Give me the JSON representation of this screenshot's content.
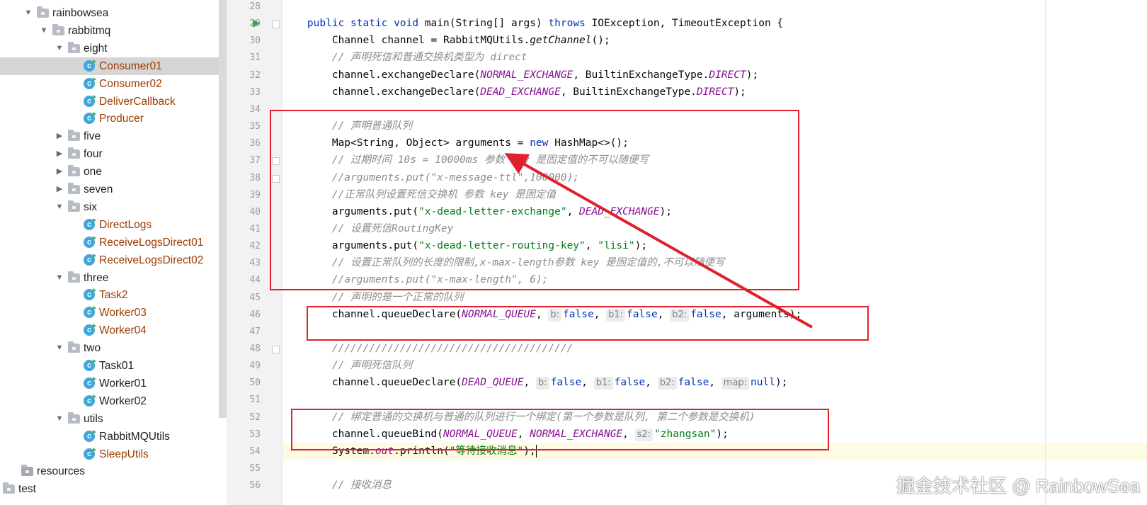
{
  "tree": {
    "items": [
      {
        "label": "rainbowsea",
        "kind": "folder",
        "expanded": true,
        "depth": 2
      },
      {
        "label": "rabbitmq",
        "kind": "folder",
        "expanded": true,
        "depth": 3
      },
      {
        "label": "eight",
        "kind": "folder",
        "expanded": true,
        "depth": 4
      },
      {
        "label": "Consumer01",
        "kind": "class",
        "depth": 5,
        "selected": true,
        "vcs": "modified"
      },
      {
        "label": "Consumer02",
        "kind": "class",
        "depth": 5,
        "vcs": "modified"
      },
      {
        "label": "DeliverCallback",
        "kind": "class",
        "depth": 5,
        "vcs": "modified"
      },
      {
        "label": "Producer",
        "kind": "class",
        "depth": 5,
        "vcs": "modified"
      },
      {
        "label": "five",
        "kind": "folder",
        "expanded": false,
        "depth": 4
      },
      {
        "label": "four",
        "kind": "folder",
        "expanded": false,
        "depth": 4
      },
      {
        "label": "one",
        "kind": "folder",
        "expanded": false,
        "depth": 4
      },
      {
        "label": "seven",
        "kind": "folder",
        "expanded": false,
        "depth": 4
      },
      {
        "label": "six",
        "kind": "folder",
        "expanded": true,
        "depth": 4
      },
      {
        "label": "DirectLogs",
        "kind": "class",
        "depth": 5,
        "vcs": "modified"
      },
      {
        "label": "ReceiveLogsDirect01",
        "kind": "class",
        "depth": 5,
        "vcs": "modified"
      },
      {
        "label": "ReceiveLogsDirect02",
        "kind": "class",
        "depth": 5,
        "vcs": "modified"
      },
      {
        "label": "three",
        "kind": "folder",
        "expanded": true,
        "depth": 4
      },
      {
        "label": "Task2",
        "kind": "class",
        "depth": 5,
        "vcs": "modified"
      },
      {
        "label": "Worker03",
        "kind": "class",
        "depth": 5,
        "vcs": "modified"
      },
      {
        "label": "Worker04",
        "kind": "class",
        "depth": 5,
        "vcs": "modified"
      },
      {
        "label": "two",
        "kind": "folder",
        "expanded": true,
        "depth": 4
      },
      {
        "label": "Task01",
        "kind": "class",
        "depth": 5,
        "vcs": "none"
      },
      {
        "label": "Worker01",
        "kind": "class",
        "depth": 5,
        "vcs": "none"
      },
      {
        "label": "Worker02",
        "kind": "class",
        "depth": 5,
        "vcs": "none"
      },
      {
        "label": "utils",
        "kind": "folder",
        "expanded": true,
        "depth": 4
      },
      {
        "label": "RabbitMQUtils",
        "kind": "class",
        "depth": 5,
        "vcs": "none"
      },
      {
        "label": "SleepUtils",
        "kind": "class",
        "depth": 5,
        "vcs": "modified"
      },
      {
        "label": "resources",
        "kind": "resource-folder",
        "depth": 1
      },
      {
        "label": "test",
        "kind": "folder-plain",
        "depth": 0
      }
    ]
  },
  "editor": {
    "lines": [
      {
        "n": "28",
        "segs": []
      },
      {
        "n": "29",
        "segs": [
          {
            "t": "    "
          },
          {
            "t": "public static void ",
            "c": "kw"
          },
          {
            "t": "main(String[] args) "
          },
          {
            "t": "throws ",
            "c": "kw"
          },
          {
            "t": "IOException, TimeoutException {"
          }
        ]
      },
      {
        "n": "30",
        "segs": [
          {
            "t": "        Channel channel = RabbitMQUtils."
          },
          {
            "t": "getChannel",
            "c": "it"
          },
          {
            "t": "();"
          }
        ]
      },
      {
        "n": "31",
        "segs": [
          {
            "t": "        "
          },
          {
            "t": "// 声明死信和普通交换机类型为 direct",
            "c": "cm"
          }
        ]
      },
      {
        "n": "32",
        "segs": [
          {
            "t": "        channel.exchangeDeclare("
          },
          {
            "t": "NORMAL_EXCHANGE",
            "c": "fd"
          },
          {
            "t": ", BuiltinExchangeType."
          },
          {
            "t": "DIRECT",
            "c": "fd"
          },
          {
            "t": ");"
          }
        ]
      },
      {
        "n": "33",
        "segs": [
          {
            "t": "        channel.exchangeDeclare("
          },
          {
            "t": "DEAD_EXCHANGE",
            "c": "fd"
          },
          {
            "t": ", BuiltinExchangeType."
          },
          {
            "t": "DIRECT",
            "c": "fd"
          },
          {
            "t": ");"
          }
        ]
      },
      {
        "n": "34",
        "segs": []
      },
      {
        "n": "35",
        "segs": [
          {
            "t": "        "
          },
          {
            "t": "// 声明普通队列",
            "c": "cm"
          }
        ]
      },
      {
        "n": "36",
        "segs": [
          {
            "t": "        Map<String, Object> arguments = "
          },
          {
            "t": "new ",
            "c": "kw"
          },
          {
            "t": "HashMap<>();"
          }
        ]
      },
      {
        "n": "37",
        "segs": [
          {
            "t": "        "
          },
          {
            "t": "// 过期时间 10s = 10000ms 参数 key 是固定值的不可以随便写",
            "c": "cm"
          }
        ]
      },
      {
        "n": "38",
        "segs": [
          {
            "t": "        "
          },
          {
            "t": "//arguments.put(\"x-message-ttl\",100000);",
            "c": "cm"
          }
        ]
      },
      {
        "n": "39",
        "segs": [
          {
            "t": "        "
          },
          {
            "t": "//正常队列设置死信交换机 参数 key 是固定值",
            "c": "cm"
          }
        ]
      },
      {
        "n": "40",
        "segs": [
          {
            "t": "        arguments.put("
          },
          {
            "t": "\"x-dead-letter-exchange\"",
            "c": "st"
          },
          {
            "t": ", "
          },
          {
            "t": "DEAD_EXCHANGE",
            "c": "fd"
          },
          {
            "t": ");"
          }
        ]
      },
      {
        "n": "41",
        "segs": [
          {
            "t": "        "
          },
          {
            "t": "// 设置死信RoutingKey",
            "c": "cm"
          }
        ]
      },
      {
        "n": "42",
        "segs": [
          {
            "t": "        arguments.put("
          },
          {
            "t": "\"x-dead-letter-routing-key\"",
            "c": "st"
          },
          {
            "t": ", "
          },
          {
            "t": "\"lisi\"",
            "c": "st"
          },
          {
            "t": ");"
          }
        ]
      },
      {
        "n": "43",
        "segs": [
          {
            "t": "        "
          },
          {
            "t": "// 设置正常队列的长度的限制,x-max-length参数 key 是固定值的,不可以随便写",
            "c": "cm"
          }
        ]
      },
      {
        "n": "44",
        "segs": [
          {
            "t": "        "
          },
          {
            "t": "//arguments.put(\"x-max-length\", 6);",
            "c": "cm"
          }
        ]
      },
      {
        "n": "45",
        "segs": [
          {
            "t": "        "
          },
          {
            "t": "// 声明的是一个正常的队列",
            "c": "cm"
          }
        ]
      },
      {
        "n": "46",
        "segs": [
          {
            "t": "        channel.queueDeclare("
          },
          {
            "t": "NORMAL_QUEUE",
            "c": "fd"
          },
          {
            "t": ", "
          },
          {
            "h": "b:"
          },
          {
            "t": "false",
            "c": "kw"
          },
          {
            "t": ", "
          },
          {
            "h": "b1:"
          },
          {
            "t": "false",
            "c": "kw"
          },
          {
            "t": ", "
          },
          {
            "h": "b2:"
          },
          {
            "t": "false",
            "c": "kw"
          },
          {
            "t": ", arguments);"
          }
        ]
      },
      {
        "n": "47",
        "segs": []
      },
      {
        "n": "48",
        "segs": [
          {
            "t": "        "
          },
          {
            "t": "///////////////////////////////////////",
            "c": "cm"
          }
        ]
      },
      {
        "n": "49",
        "segs": [
          {
            "t": "        "
          },
          {
            "t": "// 声明死信队列",
            "c": "cm"
          }
        ]
      },
      {
        "n": "50",
        "segs": [
          {
            "t": "        channel.queueDeclare("
          },
          {
            "t": "DEAD_QUEUE",
            "c": "fd"
          },
          {
            "t": ", "
          },
          {
            "h": "b:"
          },
          {
            "t": "false",
            "c": "kw"
          },
          {
            "t": ", "
          },
          {
            "h": "b1:"
          },
          {
            "t": "false",
            "c": "kw"
          },
          {
            "t": ", "
          },
          {
            "h": "b2:"
          },
          {
            "t": "false",
            "c": "kw"
          },
          {
            "t": ", "
          },
          {
            "h": "map:"
          },
          {
            "t": "null",
            "c": "kw"
          },
          {
            "t": ");"
          }
        ]
      },
      {
        "n": "51",
        "segs": []
      },
      {
        "n": "52",
        "segs": [
          {
            "t": "        "
          },
          {
            "t": "// 绑定普通的交换机与普通的队列进行一个绑定(第一个参数是队列, 第二个参数是交换机)",
            "c": "cm"
          }
        ]
      },
      {
        "n": "53",
        "segs": [
          {
            "t": "        channel.queueBind("
          },
          {
            "t": "NORMAL_QUEUE",
            "c": "fd"
          },
          {
            "t": ", "
          },
          {
            "t": "NORMAL_EXCHANGE",
            "c": "fd"
          },
          {
            "t": ", "
          },
          {
            "h": "s2:"
          },
          {
            "t": "\"zhangsan\"",
            "c": "st"
          },
          {
            "t": ");"
          }
        ]
      },
      {
        "n": "54",
        "segs": [
          {
            "t": "        System."
          },
          {
            "t": "out",
            "c": "fd"
          },
          {
            "t": ".println("
          },
          {
            "t": "\"等待接收消息\"",
            "c": "st"
          },
          {
            "t": ");"
          },
          {
            "caret": true
          }
        ],
        "current": true
      },
      {
        "n": "55",
        "segs": []
      },
      {
        "n": "56",
        "segs": [
          {
            "t": "        "
          },
          {
            "t": "// 接收消息",
            "c": "cm"
          }
        ]
      }
    ]
  },
  "watermark": "掘金技术社区 @ RainbowSea",
  "colors": {
    "annotation": "#e0212b",
    "keyword": "#0033b3",
    "string": "#067d17",
    "field": "#871094",
    "comment": "#8c8c8c"
  }
}
